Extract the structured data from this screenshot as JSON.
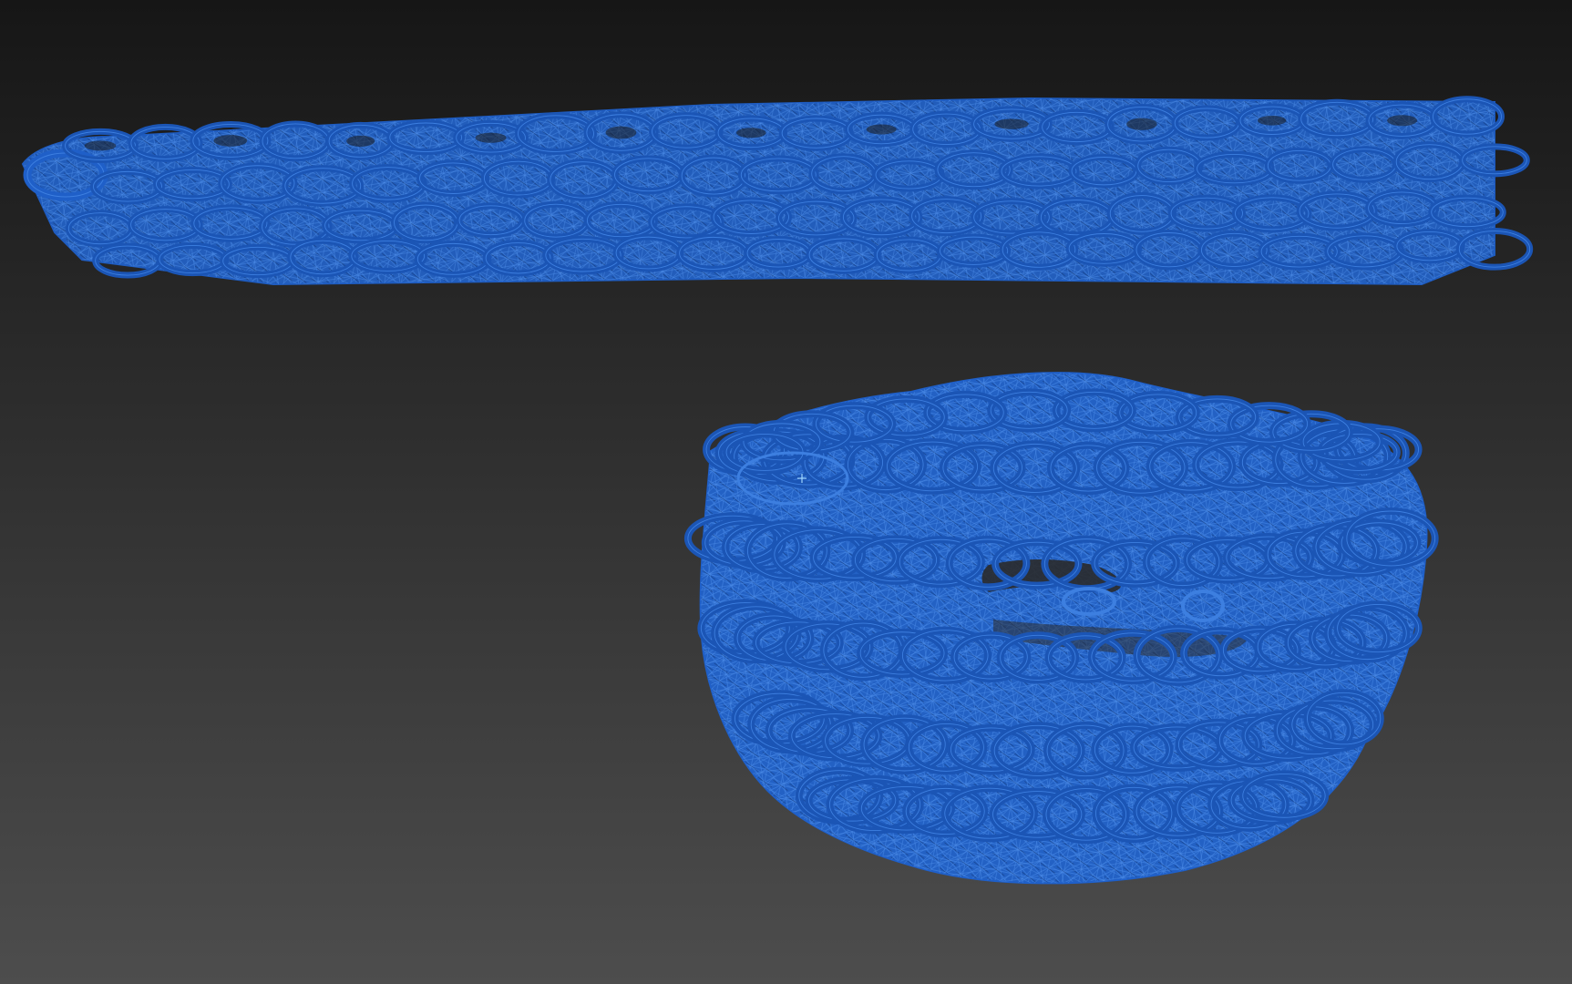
{
  "viewport": {
    "name": "3d-viewport",
    "background_top": "#161616",
    "background_bottom": "#4d4d4d",
    "wireframe_color": "#1f5fc8",
    "wireframe_fill": "#2361c4",
    "wire_line_color": "#3d7fe0",
    "dark_line_color": "#153f86",
    "shading_mode": "wireframe"
  },
  "objects": [
    {
      "name": "straight-chain-wireframe",
      "shape": "straight chain mesh"
    },
    {
      "name": "coiled-chain-wireframe",
      "shape": "coiled chain mesh"
    }
  ],
  "pivot": {
    "icon": "pivot-crosshair-icon",
    "color": "#9fd6ff"
  }
}
